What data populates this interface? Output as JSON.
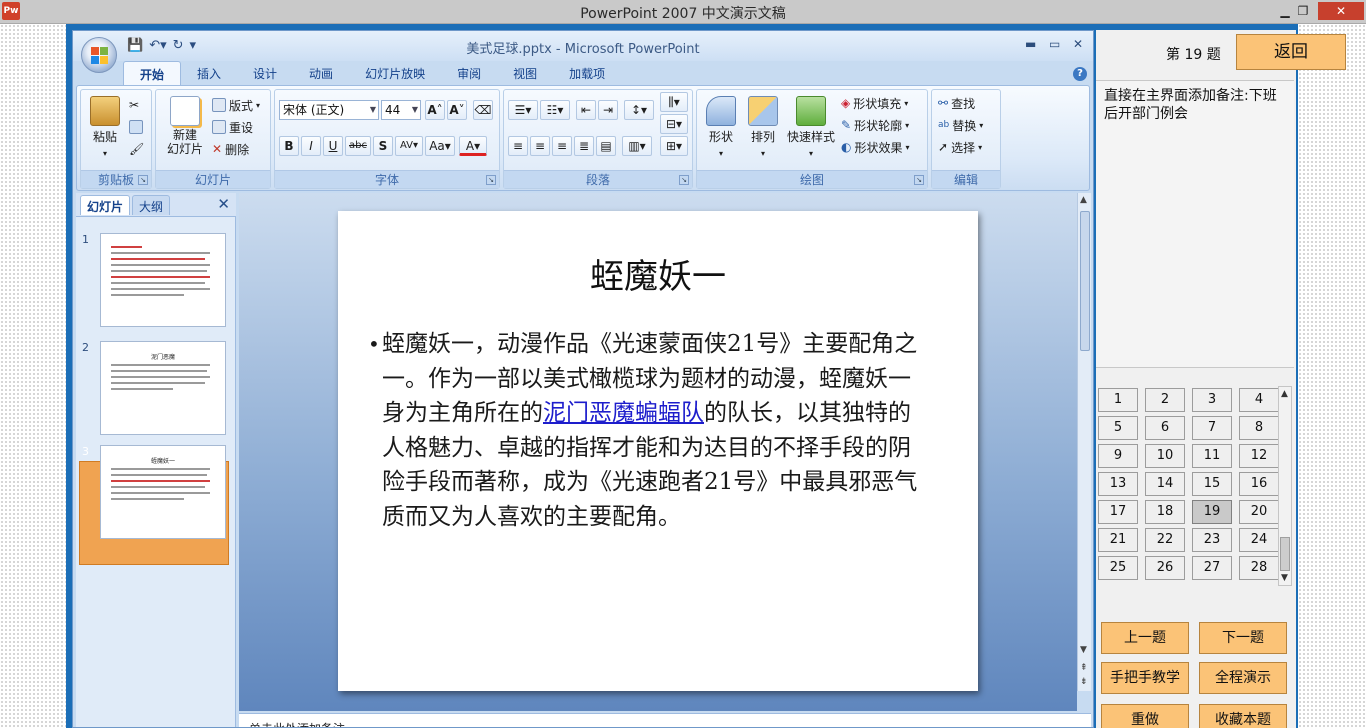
{
  "outer_window": {
    "title": "PowerPoint 2007 中文演示文稿",
    "app_badge": "Pw"
  },
  "ppt": {
    "doc_title": "美式足球.pptx - Microsoft PowerPoint",
    "tabs": [
      "开始",
      "插入",
      "设计",
      "动画",
      "幻灯片放映",
      "审阅",
      "视图",
      "加载项"
    ],
    "clipboard": {
      "paste": "粘贴",
      "group": "剪贴板"
    },
    "slides_group": {
      "new_slide": "新建\n幻灯片",
      "layout": "版式",
      "reset": "重设",
      "delete": "删除",
      "group": "幻灯片"
    },
    "font_group": {
      "font_name": "宋体 (正文)",
      "font_size": "44",
      "group": "字体"
    },
    "paragraph_group": {
      "group": "段落"
    },
    "drawing_group": {
      "shapes": "形状",
      "arrange": "排列",
      "quick_styles": "快速样式",
      "fill": "形状填充",
      "outline": "形状轮廓",
      "effects": "形状效果",
      "group": "绘图"
    },
    "editing_group": {
      "find": "查找",
      "replace": "替换",
      "select": "选择",
      "group": "编辑"
    },
    "pane_tabs": {
      "slides": "幻灯片",
      "outline": "大纲"
    },
    "thumbnails": [
      {
        "num": "1"
      },
      {
        "num": "2",
        "title": "泥门恶魔"
      },
      {
        "num": "3",
        "title": "蛭魔妖一"
      }
    ],
    "slide": {
      "title": "蛭魔妖一",
      "body_before_link": "蛭魔妖一，动漫作品《光速蒙面侠21号》主要配角之一。作为一部以美式橄榄球为题材的动漫，蛭魔妖一身为主角所在的",
      "body_link": "泥门恶魔蝙蝠队",
      "body_after_link": "的队长，以其独特的人格魅力、卓越的指挥才能和为达目的不择手段的阴险手段而著称，成为《光速跑者21号》中最具邪恶气质而又为人喜欢的主要配角。"
    },
    "notes_placeholder": "单击此处添加备注"
  },
  "panel": {
    "question_label": "第 19 题",
    "back": "返回",
    "question_text": "直接在主界面添加备注:下班后开部门例会",
    "numbers": [
      "1",
      "2",
      "3",
      "4",
      "5",
      "6",
      "7",
      "8",
      "9",
      "10",
      "11",
      "12",
      "13",
      "14",
      "15",
      "16",
      "17",
      "18",
      "19",
      "20",
      "21",
      "22",
      "23",
      "24",
      "25",
      "26",
      "27",
      "28"
    ],
    "current": "19",
    "prev": "上一题",
    "next": "下一题",
    "teach": "手把手教学",
    "demo": "全程演示",
    "redo": "重做",
    "favorite": "收藏本题"
  }
}
